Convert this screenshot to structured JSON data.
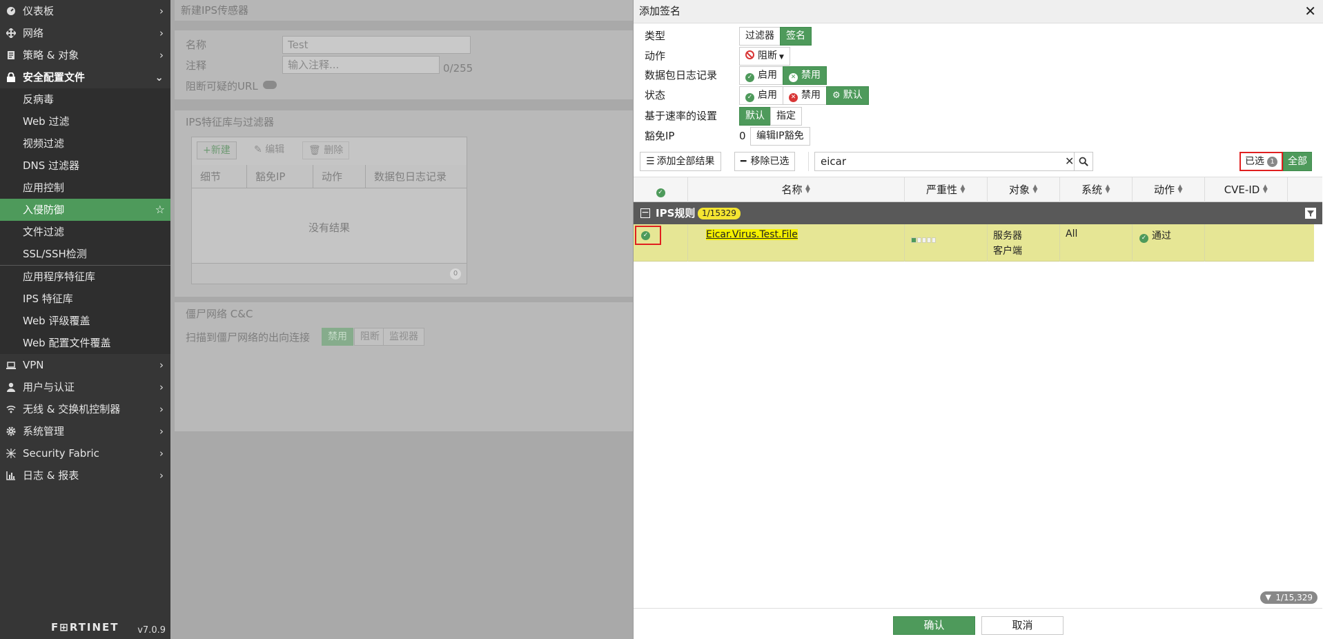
{
  "sidebar": {
    "items": [
      {
        "label": "仪表板",
        "icon": "dashboard-icon"
      },
      {
        "label": "网络",
        "icon": "network-icon"
      },
      {
        "label": "策略 & 对象",
        "icon": "policy-icon"
      },
      {
        "label": "安全配置文件",
        "icon": "lock-icon"
      }
    ],
    "sub_items": [
      "反病毒",
      "Web 过滤",
      "视频过滤",
      "DNS 过滤器",
      "应用控制",
      "入侵防御",
      "文件过滤",
      "SSL/SSH检测"
    ],
    "sub_items2": [
      "应用程序特征库",
      "IPS 特征库",
      "Web 评级覆盖",
      "Web 配置文件覆盖"
    ],
    "items_after": [
      {
        "label": "VPN",
        "icon": "laptop-icon"
      },
      {
        "label": "用户与认证",
        "icon": "user-icon"
      },
      {
        "label": "无线 & 交换机控制器",
        "icon": "wifi-icon"
      },
      {
        "label": "系统管理",
        "icon": "gear-icon"
      },
      {
        "label": "Security Fabric",
        "icon": "fabric-icon"
      },
      {
        "label": "日志 & 报表",
        "icon": "chart-icon"
      }
    ],
    "brand": "F⊞RTINET",
    "version": "v7.0.9"
  },
  "background_form": {
    "title": "新建IPS传感器",
    "name_label": "名称",
    "name_value": "Test",
    "comment_label": "注释",
    "comment_placeholder": "输入注释...",
    "comment_counter": "0/255",
    "block_url_label": "阻断可疑的URL",
    "section_title": "IPS特征库与过滤器",
    "new_btn": "+新建",
    "edit_btn": "编辑",
    "delete_btn": "删除",
    "columns": [
      "细节",
      "豁免IP",
      "动作",
      "数据包日志记录"
    ],
    "empty_text": "没有结果",
    "empty_count": "0",
    "botnet_title": "僵尸网络 C&C",
    "botnet_label": "扫描到僵尸网络的出向连接",
    "botnet_options": [
      "禁用",
      "阻断",
      "监视器"
    ]
  },
  "panel": {
    "title": "添加签名",
    "type_label": "类型",
    "type_options": [
      "过滤器",
      "签名"
    ],
    "action_label": "动作",
    "action_value": "阻断",
    "pktlog_label": "数据包日志记录",
    "pktlog_options": [
      "启用",
      "禁用"
    ],
    "status_label": "状态",
    "status_options": [
      "启用",
      "禁用",
      "默认"
    ],
    "rate_label": "基于速率的设置",
    "rate_options": [
      "默认",
      "指定"
    ],
    "exempt_label": "豁免IP",
    "exempt_count": "0",
    "exempt_button": "编辑IP豁免",
    "add_all_button": "添加全部结果",
    "remove_selected_button": "移除已选",
    "search_value": "eicar",
    "selected_label": "已选",
    "selected_count": "1",
    "all_label": "全部",
    "columns": [
      "名称",
      "严重性",
      "对象",
      "系统",
      "动作",
      "CVE-ID"
    ],
    "group_label": "IPS规则",
    "group_count": "1/15329",
    "row": {
      "name": "Eicar.Virus.Test.File",
      "severity_level": 1,
      "severity_max": 5,
      "target_line1": "服务器",
      "target_line2": "客户端",
      "os": "All",
      "action": "通过",
      "cve": ""
    },
    "footer_count": "1/15,329",
    "ok_button": "确认",
    "cancel_button": "取消"
  },
  "colors": {
    "accent_green": "#4e9a5b",
    "highlight_yellow": "#e6e695",
    "red": "#e01f1f"
  }
}
